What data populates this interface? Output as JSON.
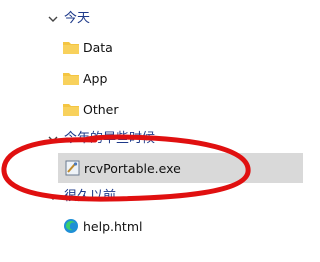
{
  "groups": [
    {
      "label": "今天",
      "items": [
        "Data",
        "App",
        "Other"
      ]
    },
    {
      "label": "今年的早些时候",
      "items": [
        "rcvPortable.exe"
      ]
    },
    {
      "label": "很久以前",
      "items": [
        "help.html"
      ]
    }
  ],
  "colors": {
    "group_text": "#1e3a8a",
    "folder_yellow": "#f4c542",
    "selection": "#d9d9d9",
    "annotation_red": "#e01010"
  },
  "icons": {
    "folder": "folder-icon",
    "exe": "exe-file-icon",
    "edge": "edge-browser-icon",
    "chevron": "chevron-down-icon"
  }
}
